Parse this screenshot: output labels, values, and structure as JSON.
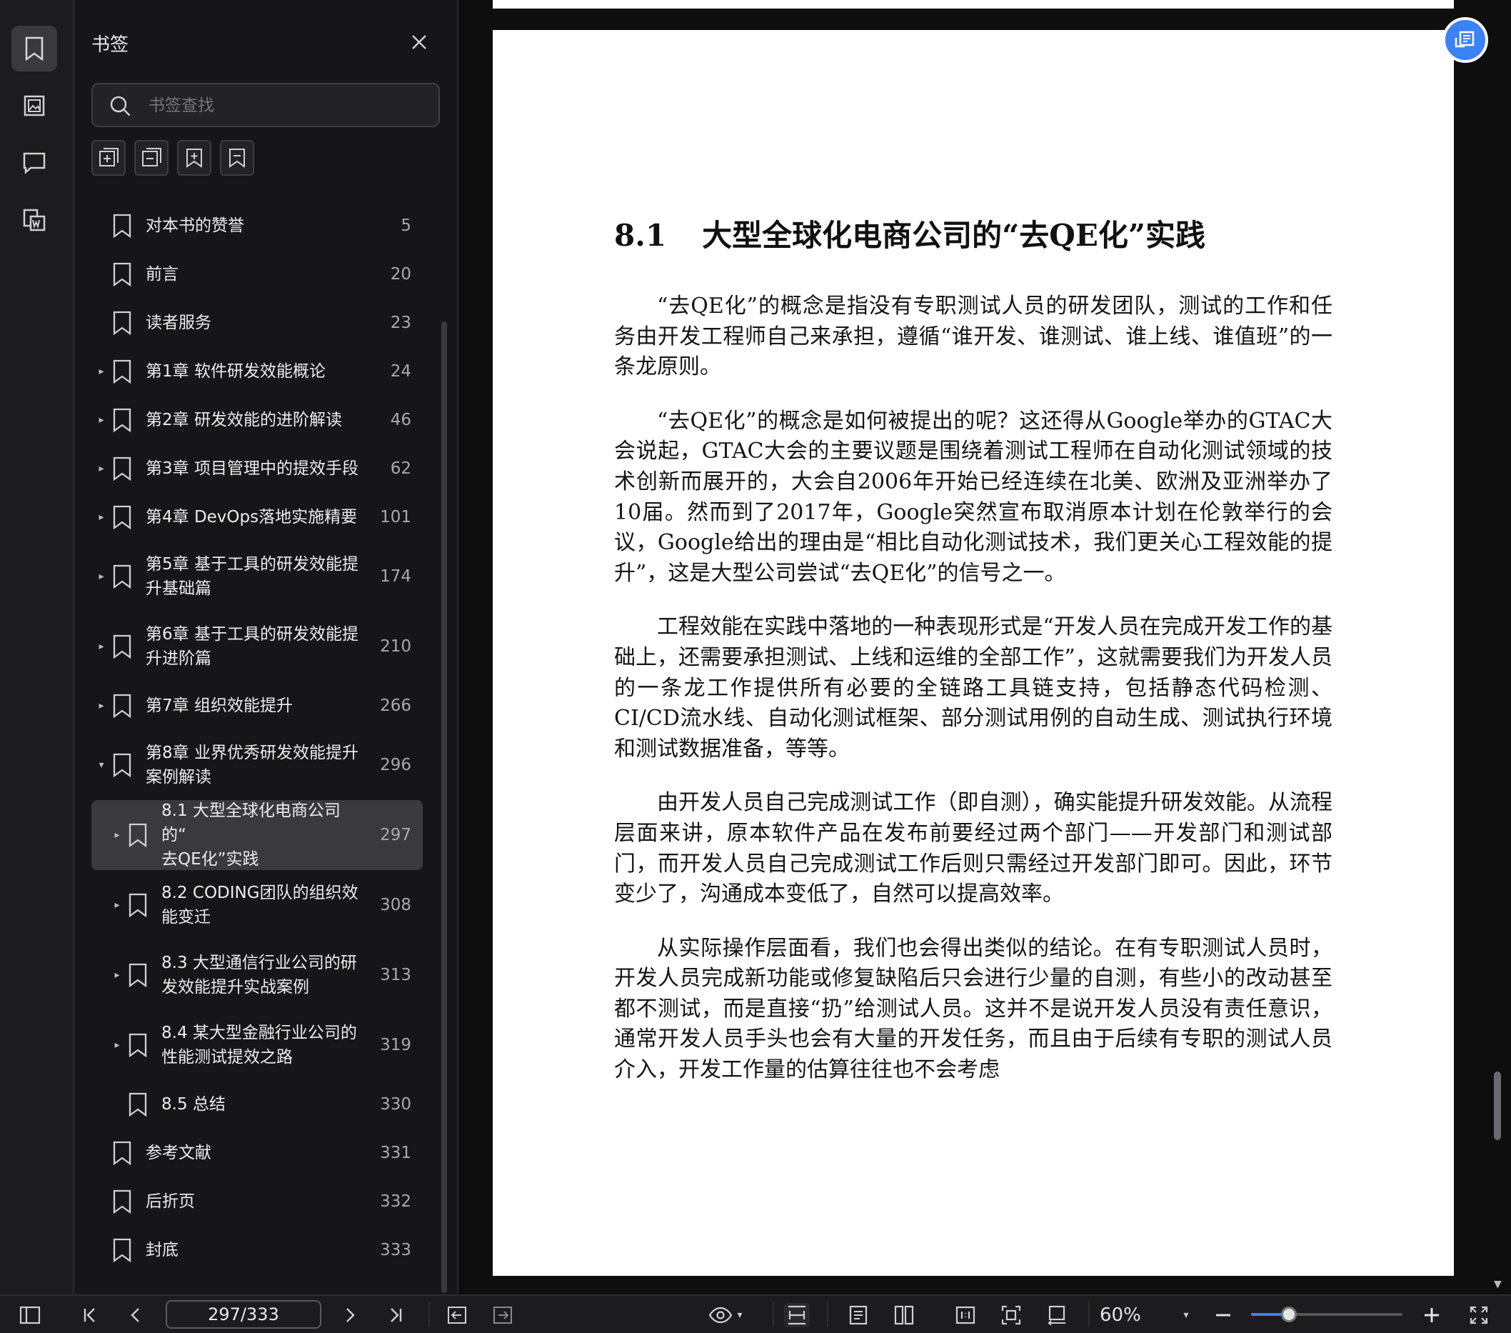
{
  "sidebar": {
    "title": "书签",
    "search_placeholder": "书签查找",
    "rail": [
      "bookmark-icon",
      "image-icon",
      "comment-icon",
      "word-export-icon"
    ],
    "tools": [
      "add-bookmark-icon",
      "collapse-bookmark-icon",
      "bookmark-plus-icon",
      "bookmark-icon"
    ],
    "bookmarks": [
      {
        "label": "对本书的赞誉",
        "page": "5",
        "level": 0,
        "caret": ""
      },
      {
        "label": "前言",
        "page": "20",
        "level": 0,
        "caret": ""
      },
      {
        "label": "读者服务",
        "page": "23",
        "level": 0,
        "caret": ""
      },
      {
        "label": "第1章 软件研发效能概论",
        "page": "24",
        "level": 0,
        "caret": "▸"
      },
      {
        "label": "第2章 研发效能的进阶解读",
        "page": "46",
        "level": 0,
        "caret": "▸"
      },
      {
        "label": "第3章 项目管理中的提效手段",
        "page": "62",
        "level": 0,
        "caret": "▸"
      },
      {
        "label": "第4章 DevOps落地实施精要",
        "page": "101",
        "level": 0,
        "caret": "▸"
      },
      {
        "label": "第5章 基于工具的研发效能提\n升基础篇",
        "page": "174",
        "level": 0,
        "caret": "▸"
      },
      {
        "label": "第6章 基于工具的研发效能提\n升进阶篇",
        "page": "210",
        "level": 0,
        "caret": "▸"
      },
      {
        "label": "第7章 组织效能提升",
        "page": "266",
        "level": 0,
        "caret": "▸"
      },
      {
        "label": "第8章 业界优秀研发效能提升\n案例解读",
        "page": "296",
        "level": 0,
        "caret": "▾"
      },
      {
        "label": "8.1 大型全球化电商公司的“\n去QE化”实践",
        "page": "297",
        "level": 1,
        "caret": "▸",
        "active": true
      },
      {
        "label": "8.2 CODING团队的组织效\n能变迁",
        "page": "308",
        "level": 1,
        "caret": "▸"
      },
      {
        "label": "8.3 大型通信行业公司的研\n发效能提升实战案例",
        "page": "313",
        "level": 1,
        "caret": "▸"
      },
      {
        "label": "8.4 某大型金融行业公司的\n性能测试提效之路",
        "page": "319",
        "level": 1,
        "caret": "▸"
      },
      {
        "label": "8.5 总结",
        "page": "330",
        "level": 1,
        "caret": ""
      },
      {
        "label": "参考文献",
        "page": "331",
        "level": 0,
        "caret": ""
      },
      {
        "label": "后折页",
        "page": "332",
        "level": 0,
        "caret": ""
      },
      {
        "label": "封底",
        "page": "333",
        "level": 0,
        "caret": ""
      }
    ]
  },
  "document": {
    "section_number": "8.1",
    "section_title": "大型全球化电商公司的“去QE化”实践",
    "paragraphs": [
      "“去QE化”的概念是指没有专职测试人员的研发团队，测试的工作和任务由开发工程师自己来承担，遵循“谁开发、谁测试、谁上线、谁值班”的一条龙原则。",
      "“去QE化”的概念是如何被提出的呢？这还得从Google举办的GTAC大会说起，GTAC大会的主要议题是围绕着测试工程师在自动化测试领域的技术创新而展开的，大会自2006年开始已经连续在北美、欧洲及亚洲举办了10届。然而到了2017年，Google突然宣布取消原本计划在伦敦举行的会议，Google给出的理由是“相比自动化测试技术，我们更关心工程效能的提升”，这是大型公司尝试“去QE化”的信号之一。",
      "工程效能在实践中落地的一种表现形式是“开发人员在完成开发工作的基础上，还需要承担测试、上线和运维的全部工作”，这就需要我们为开发人员的一条龙工作提供所有必要的全链路工具链支持，包括静态代码检测、CI/CD流水线、自动化测试框架、部分测试用例的自动生成、测试执行环境和测试数据准备，等等。",
      "由开发人员自己完成测试工作（即自测），确实能提升研发效能。从流程层面来讲，原本软件产品在发布前要经过两个部门——开发部门和测试部门，而开发人员自己完成测试工作后则只需经过开发部门即可。因此，环节变少了，沟通成本变低了，自然可以提高效率。",
      "从实际操作层面看，我们也会得出类似的结论。在有专职测试人员时，开发人员完成新功能或修复缺陷后只会进行少量的自测，有些小的改动甚至都不测试，而是直接“扔”给测试人员。这并不是说开发人员没有责任意识，通常开发人员手头也会有大量的开发任务，而且由于后续有专职的测试人员介入，开发工作量的估算往往也不会考虑"
    ]
  },
  "toolbar": {
    "page_indicator": "297/333",
    "zoom": "60%",
    "zoom_fraction": 0.25,
    "accent": "#3b82f6"
  }
}
